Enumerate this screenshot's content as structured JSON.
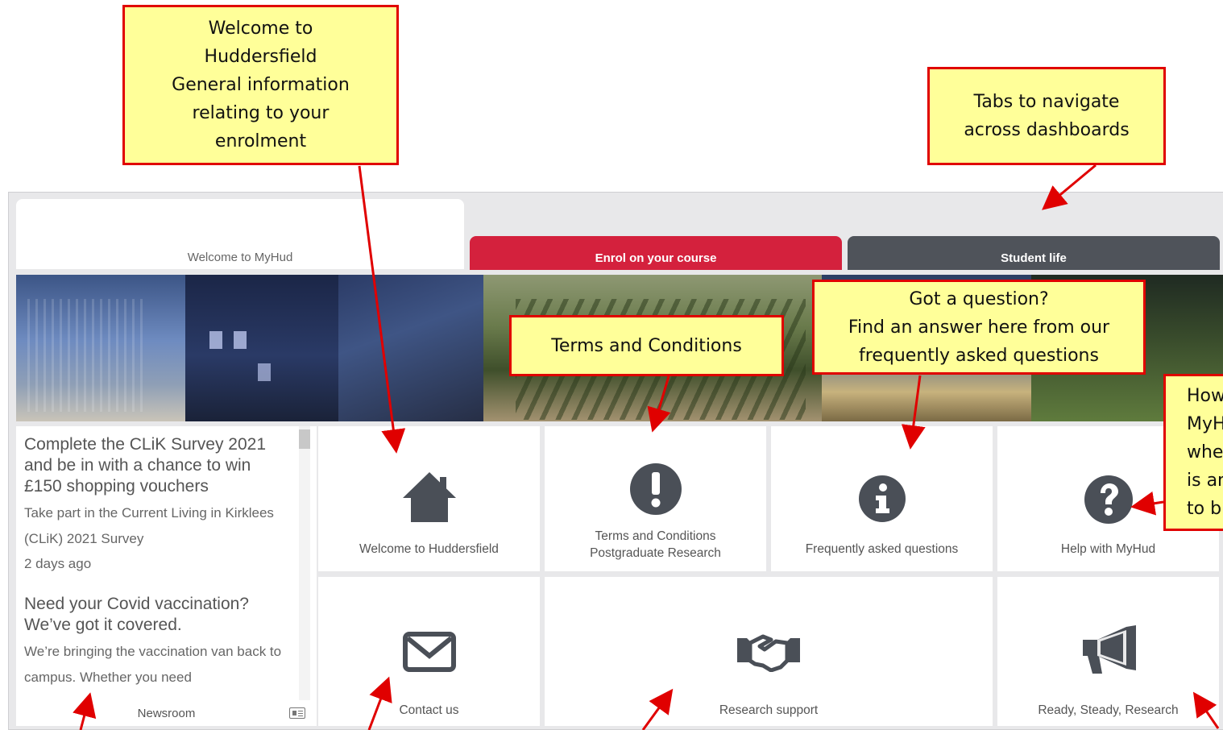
{
  "tabs": [
    {
      "label": "Welcome to MyHud"
    },
    {
      "label": "Enrol on your course"
    },
    {
      "label": "Student life"
    }
  ],
  "news": {
    "items": [
      {
        "title": "Complete the CLiK Survey 2021 and be in with a chance to win £150 shopping vouchers",
        "description": "Take part in the Current Living in Kirklees (CLiK) 2021 Survey",
        "time": "2 days ago"
      },
      {
        "title": "Need your Covid vaccination? We’ve got it covered.",
        "description": "We’re bringing the vaccination van back to campus. Whether you need"
      }
    ],
    "footer_label": "Newsroom"
  },
  "tiles": [
    {
      "label": "Welcome to Huddersfield",
      "icon": "home-icon"
    },
    {
      "label": "Terms and Conditions Postgraduate Research",
      "icon": "exclamation-circle-icon"
    },
    {
      "label": "Frequently asked questions",
      "icon": "info-circle-icon"
    },
    {
      "label": "Help with MyHud",
      "icon": "question-circle-icon"
    },
    {
      "label": "Contact us",
      "icon": "envelope-icon"
    },
    {
      "label": "Research support",
      "icon": "handshake-icon"
    },
    {
      "label": "Ready, Steady, Research",
      "icon": "megaphone-icon"
    }
  ],
  "callouts": {
    "welcome_line1": "Welcome to",
    "welcome_line2": "Huddersfield",
    "welcome_line3": "General information",
    "welcome_line4": "relating to your",
    "welcome_line5": "enrolment",
    "tabs_line1": "Tabs to navigate",
    "tabs_line2": "across dashboards",
    "terms": "Terms and Conditions",
    "faq_line1": "Got a question?",
    "faq_line2": "Find an answer here from our",
    "faq_line3": "frequently asked questions",
    "help_line1": "How",
    "help_line2": "MyH",
    "help_line3": "whe",
    "help_line4": "is an",
    "help_line5": "to b"
  },
  "colors": {
    "enrol_tab": "#d4213d",
    "student_tab": "#4f535a",
    "callout_fill": "#ffff99",
    "callout_border": "#e00000",
    "icon": "#4a4f57"
  }
}
